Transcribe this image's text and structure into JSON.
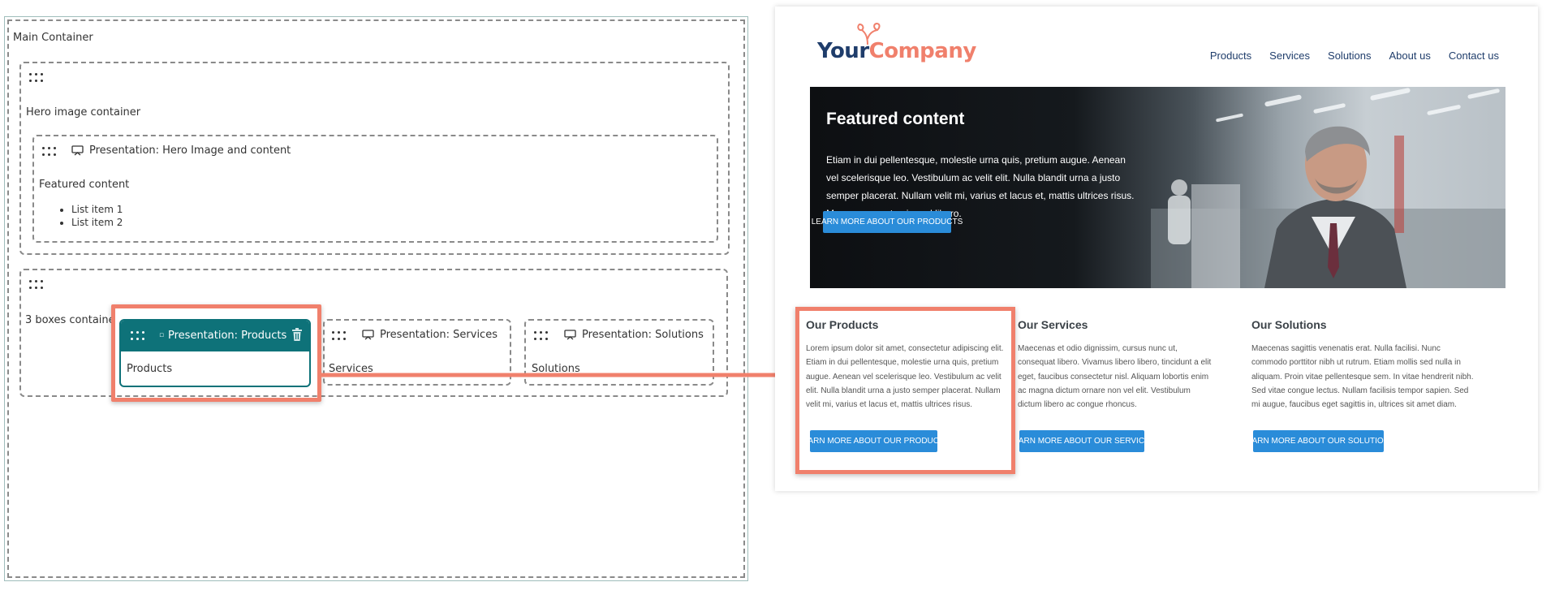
{
  "editor": {
    "main_container_label": "Main Container",
    "hero_container_label": "Hero image container",
    "hero_presentation_label": "Presentation: Hero Image and content",
    "hero_content_label": "Featured content",
    "hero_list": [
      "List item 1",
      "List item 2"
    ],
    "boxes_container_label": "3 boxes containe",
    "selected_presentation_label": "Presentation: Products",
    "selected_content": "Products",
    "services_presentation_label": "Presentation: Services",
    "services_content": "Services",
    "solutions_presentation_label": "Presentation: Solutions",
    "solutions_content": "Solutions"
  },
  "site": {
    "logo_part1": "Your",
    "logo_part2": "Company",
    "nav": [
      "Products",
      "Services",
      "Solutions",
      "About us",
      "Contact us"
    ],
    "hero": {
      "title": "Featured content",
      "text": "Etiam in dui pellentesque, molestie urna quis, pretium augue. Aenean vel scelerisque leo. Vestibulum ac velit elit. Nulla blandit urna a justo semper placerat. Nullam velit mi, varius et lacus et, mattis ultrices risus. Maecenas eget euismod libero.",
      "button": "LEARN MORE ABOUT OUR PRODUCTS"
    },
    "columns": [
      {
        "title": "Our Products",
        "text": "Lorem ipsum dolor sit amet, consectetur adipiscing elit. Etiam in dui pellentesque, molestie urna quis, pretium augue. Aenean vel scelerisque leo. Vestibulum ac velit elit. Nulla blandit urna a justo semper placerat. Nullam velit mi, varius et lacus et, mattis ultrices risus.",
        "button": "LEARN MORE ABOUT OUR PRODUCTS"
      },
      {
        "title": "Our Services",
        "text": "Maecenas et odio dignissim, cursus nunc ut, consequat libero. Vivamus libero libero, tincidunt a elit eget, faucibus consectetur nisl. Aliquam lobortis enim ac magna dictum ornare non vel elit. Vestibulum dictum libero ac congue rhoncus.",
        "button": "LEARN MORE ABOUT OUR SERVICES"
      },
      {
        "title": "Our Solutions",
        "text": "Maecenas sagittis venenatis erat. Nulla facilisi. Nunc commodo porttitor nibh ut rutrum. Etiam mollis sed nulla in aliquam. Proin vitae pellentesque sem. In vitae hendrerit nibh. Sed vitae congue lectus. Nullam facilisis tempor sapien. Sed mi augue, faucibus eget sagittis in, ultrices sit amet diam.",
        "button": "LEARN MORE ABOUT OUR SOLUTIONS"
      }
    ]
  },
  "colors": {
    "teal": "#0e7279",
    "highlight": "#f0806c",
    "button_blue": "#2a8cd9",
    "navy": "#1f3d6b"
  },
  "icons": {
    "grip": "drag-handle-icon",
    "presentation": "presentation-icon",
    "trash": "trash-icon",
    "logo_leaf": "leaf-icon"
  }
}
